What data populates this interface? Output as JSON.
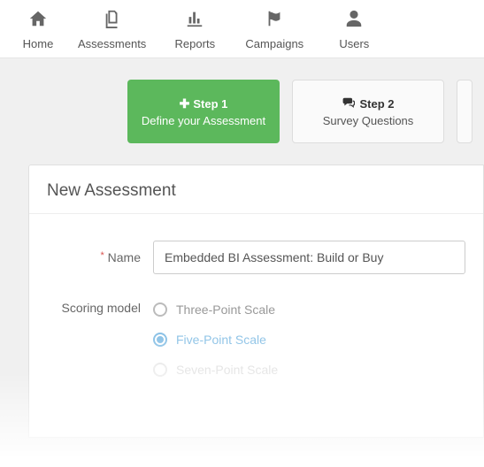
{
  "nav": {
    "home": "Home",
    "assessments": "Assessments",
    "reports": "Reports",
    "campaigns": "Campaigns",
    "users": "Users"
  },
  "steps": {
    "step1": {
      "title": "Step 1",
      "subtitle": "Define your Assessment"
    },
    "step2": {
      "title": "Step 2",
      "subtitle": "Survey Questions"
    }
  },
  "card": {
    "title": "New Assessment"
  },
  "form": {
    "name_label": "Name",
    "name_value": "Embedded BI Assessment: Build or Buy",
    "scoring_label": "Scoring model",
    "scoring_options": {
      "three": "Three-Point Scale",
      "five": "Five-Point Scale",
      "seven": "Seven-Point Scale"
    }
  }
}
